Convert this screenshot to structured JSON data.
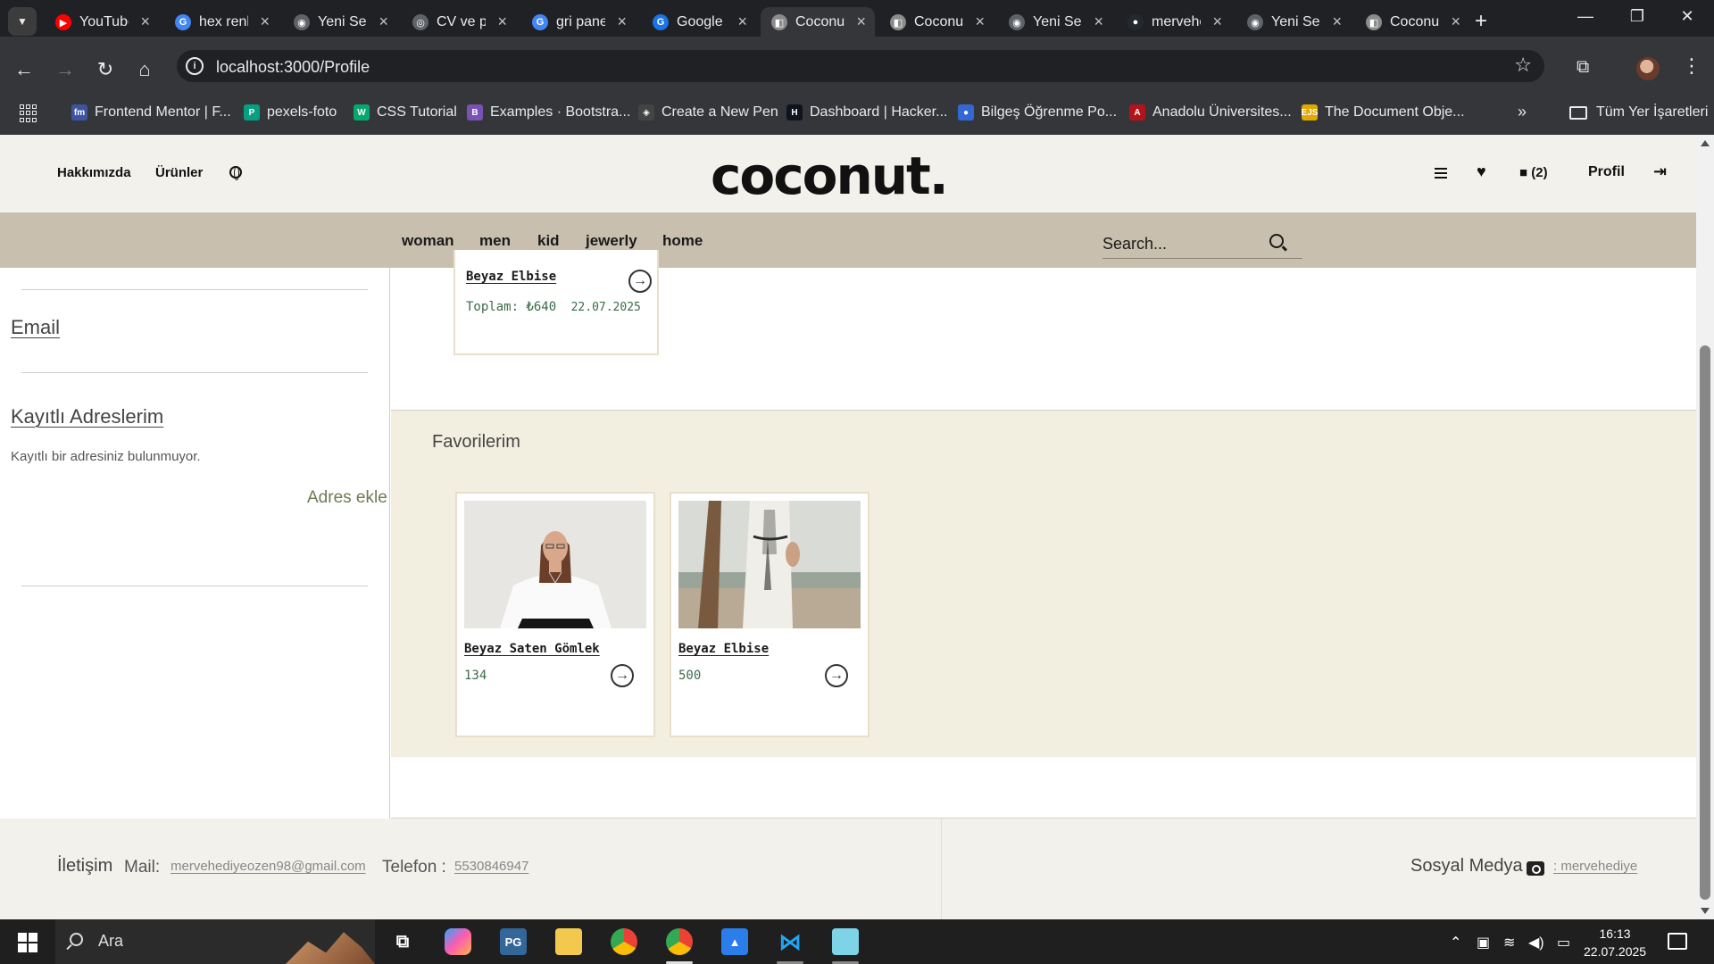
{
  "browser": {
    "tabs": [
      {
        "title": "YouTube",
        "fav_color": "#ff0000",
        "fav_glyph": "▶",
        "active": false
      },
      {
        "title": "hex renk",
        "fav_color": "#4285f4",
        "fav_glyph": "G",
        "active": false
      },
      {
        "title": "Yeni Sekme",
        "fav_color": "#5f6368",
        "fav_glyph": "◉",
        "active": false
      },
      {
        "title": "CV ve port",
        "fav_color": "#5f6368",
        "fav_glyph": "◎",
        "active": false
      },
      {
        "title": "gri panel",
        "fav_color": "#4285f4",
        "fav_glyph": "G",
        "active": false
      },
      {
        "title": "Google Translate",
        "fav_color": "#1a73e8",
        "fav_glyph": "G",
        "active": false
      },
      {
        "title": "Coconut",
        "fav_color": "#8b8b8b",
        "fav_glyph": "◧",
        "active": true
      },
      {
        "title": "Coconut",
        "fav_color": "#8b8b8b",
        "fav_glyph": "◧",
        "active": false
      },
      {
        "title": "Yeni Sekme",
        "fav_color": "#5f6368",
        "fav_glyph": "◉",
        "active": false
      },
      {
        "title": "mervehediye",
        "fav_color": "#24292e",
        "fav_glyph": "●",
        "active": false
      },
      {
        "title": "Yeni Sekme",
        "fav_color": "#5f6368",
        "fav_glyph": "◉",
        "active": false
      },
      {
        "title": "Coconut",
        "fav_color": "#8b8b8b",
        "fav_glyph": "◧",
        "active": false
      }
    ],
    "url": "localhost:3000/Profile",
    "bookmarks": [
      {
        "label": "Frontend Mentor | F...",
        "color": "#3e54a3",
        "glyph": "fm"
      },
      {
        "label": "pexels-foto",
        "color": "#05a081",
        "glyph": "P"
      },
      {
        "label": "CSS Tutorial",
        "color": "#04aa6d",
        "glyph": "W"
      },
      {
        "label": "Examples · Bootstra...",
        "color": "#7952b3",
        "glyph": "B"
      },
      {
        "label": "Create a New Pen",
        "color": "#444444",
        "glyph": "◈"
      },
      {
        "label": "Dashboard | Hacker...",
        "color": "#0e141e",
        "glyph": "H"
      },
      {
        "label": "Bilgeş Öğrenme Po...",
        "color": "#3367d6",
        "glyph": "●"
      },
      {
        "label": "Anadolu Üniversites...",
        "color": "#b3131b",
        "glyph": "A"
      },
      {
        "label": "The Document Obje...",
        "color": "#e0a800",
        "glyph": "EJS"
      }
    ],
    "bookmarks_folder": "Tüm Yer İşaretleri"
  },
  "site": {
    "header": {
      "about": "Hakkımızda",
      "products": "Ürünler",
      "logo": "coconut.",
      "cart_count": "(2)",
      "profile": "Profil"
    },
    "categories": [
      "woman",
      "men",
      "kid",
      "jewerly",
      "home"
    ],
    "search_placeholder": "Search..."
  },
  "profile": {
    "email_title": "Email",
    "addresses_title": "Kayıtlı Adreslerim",
    "no_address": "Kayıtlı bir adresiniz bulunmuyor.",
    "add_address": "Adres ekle"
  },
  "order_card": {
    "name": "Beyaz Elbise",
    "total": "Toplam: ₺640",
    "date": "22.07.2025"
  },
  "favorites": {
    "title": "Favorilerim",
    "items": [
      {
        "name": "Beyaz Saten Gömlek",
        "price": "134"
      },
      {
        "name": "Beyaz Elbise",
        "price": "500"
      }
    ]
  },
  "footer": {
    "contact_title": "İletişim",
    "mail_label": "Mail:",
    "mail": "mervehediyeozen98@gmail.com",
    "phone_label": "Telefon :",
    "phone": "5530846947",
    "social_title": "Sosyal Medya",
    "instagram": ": mervehediye"
  },
  "taskbar": {
    "search": "Ara",
    "time": "16:13",
    "date": "22.07.2025"
  }
}
